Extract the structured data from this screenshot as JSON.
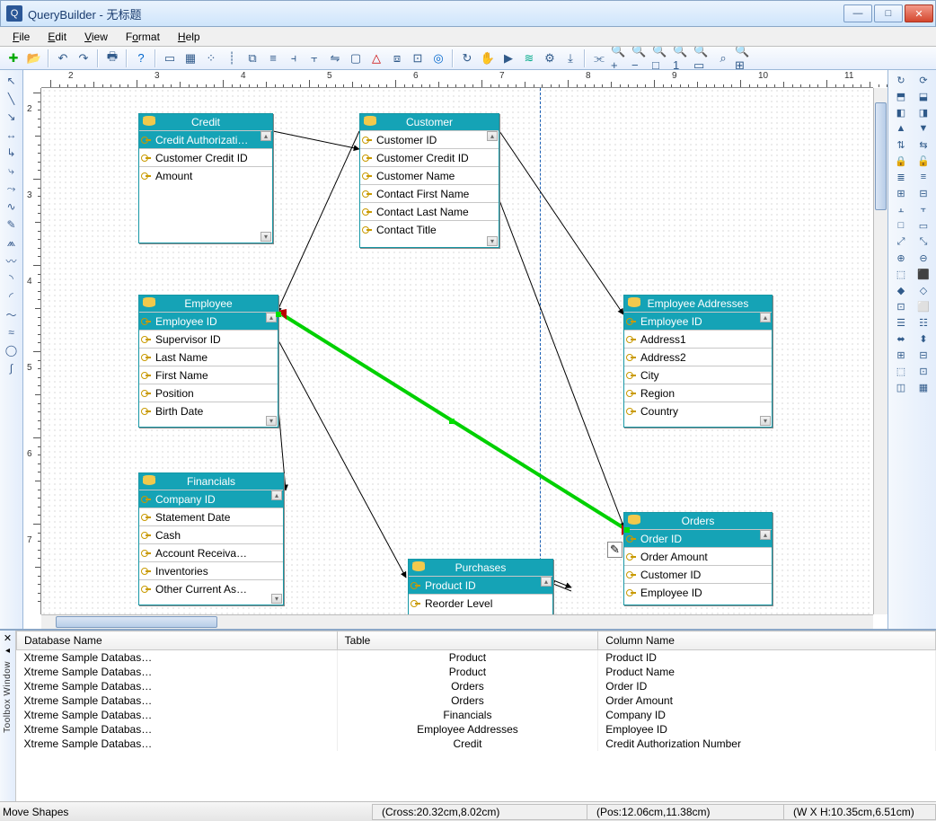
{
  "titlebar": {
    "app": "QueryBuilder",
    "doc": "无标题"
  },
  "menu": {
    "file": "File",
    "edit": "Edit",
    "view": "View",
    "format": "Format",
    "help": "Help"
  },
  "ruler_h": [
    "2",
    "3",
    "4",
    "5",
    "6",
    "7",
    "8",
    "9",
    "10",
    "11"
  ],
  "ruler_v": [
    "2",
    "3",
    "4",
    "5",
    "6",
    "7"
  ],
  "entities": {
    "credit": {
      "title": "Credit",
      "fields": [
        "Credit Authorizati…",
        "Customer Credit ID",
        "Amount"
      ],
      "selected": 0
    },
    "customer": {
      "title": "Customer",
      "fields": [
        "Customer ID",
        "Customer Credit ID",
        "Customer Name",
        "Contact First Name",
        "Contact Last Name",
        "Contact Title"
      ],
      "selected": -1
    },
    "employee": {
      "title": "Employee",
      "fields": [
        "Employee ID",
        "Supervisor ID",
        "Last Name",
        "First Name",
        "Position",
        "Birth Date"
      ],
      "selected": 0
    },
    "employee_addresses": {
      "title": "Employee Addresses",
      "fields": [
        "Employee ID",
        "Address1",
        "Address2",
        "City",
        "Region",
        "Country"
      ],
      "selected": 0
    },
    "financials": {
      "title": "Financials",
      "fields": [
        "Company ID",
        "Statement Date",
        "Cash",
        "Account Receiva…",
        "Inventories",
        "Other Current As…"
      ],
      "selected": 0
    },
    "purchases": {
      "title": "Purchases",
      "fields": [
        "Product ID",
        "Reorder Level"
      ],
      "selected": 0
    },
    "orders": {
      "title": "Orders",
      "fields": [
        "Order ID",
        "Order Amount",
        "Customer ID",
        "Employee ID"
      ],
      "selected": 0
    }
  },
  "grid": {
    "headers": [
      "Database Name",
      "Table",
      "Column Name"
    ],
    "rows": [
      [
        "Xtreme Sample Databas…",
        "Product",
        "Product ID"
      ],
      [
        "Xtreme Sample Databas…",
        "Product",
        "Product Name"
      ],
      [
        "Xtreme Sample Databas…",
        "Orders",
        "Order ID"
      ],
      [
        "Xtreme Sample Databas…",
        "Orders",
        "Order Amount"
      ],
      [
        "Xtreme Sample Databas…",
        "Financials",
        "Company ID"
      ],
      [
        "Xtreme Sample Databas…",
        "Employee Addresses",
        "Employee ID"
      ],
      [
        "Xtreme Sample Databas…",
        "Credit",
        "Credit Authorization Number"
      ]
    ]
  },
  "bottom_panel_label": "Toolbox Window",
  "status": {
    "mode": "Move Shapes",
    "cross": "(Cross:20.32cm,8.02cm)",
    "pos": "(Pos:12.06cm,11.38cm)",
    "size": "(W X H:10.35cm,6.51cm)"
  }
}
